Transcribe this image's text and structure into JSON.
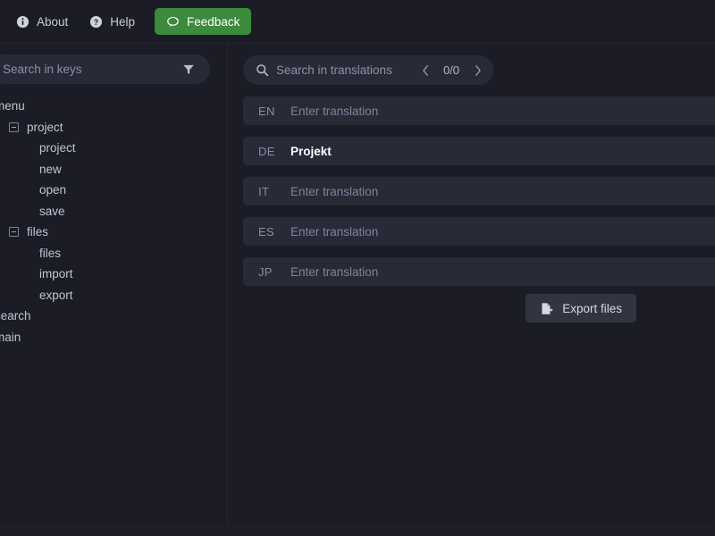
{
  "topbar": {
    "items": [
      {
        "label": "About",
        "icon": "info-circle-icon",
        "variant": "plain"
      },
      {
        "label": "Help",
        "icon": "question-circle-icon",
        "variant": "plain"
      },
      {
        "label": "Feedback",
        "icon": "speech-bubble-icon",
        "variant": "accent"
      }
    ],
    "accent_color": "#3c8b3c"
  },
  "sidebar": {
    "search": {
      "placeholder": "Search in keys",
      "value": "",
      "filter_icon": "filter-funnel-icon"
    },
    "tree": [
      {
        "label": "menu",
        "depth": 0,
        "expandable": false
      },
      {
        "label": "project",
        "depth": 1,
        "expandable": true
      },
      {
        "label": "project",
        "depth": 2,
        "expandable": false
      },
      {
        "label": "new",
        "depth": 2,
        "expandable": false
      },
      {
        "label": "open",
        "depth": 2,
        "expandable": false
      },
      {
        "label": "save",
        "depth": 2,
        "expandable": false
      },
      {
        "label": "files",
        "depth": 1,
        "expandable": true
      },
      {
        "label": "files",
        "depth": 2,
        "expandable": false
      },
      {
        "label": "import",
        "depth": 2,
        "expandable": false
      },
      {
        "label": "export",
        "depth": 2,
        "expandable": false
      },
      {
        "label": "search",
        "depth": 0,
        "expandable": false
      },
      {
        "label": "main",
        "depth": 0,
        "expandable": false
      }
    ]
  },
  "main": {
    "search": {
      "placeholder": "Search in translations",
      "value": "",
      "search_icon": "magnifier-icon",
      "prev_icon": "chevron-left-icon",
      "next_icon": "chevron-right-icon",
      "match_count": "0/0"
    },
    "translations": [
      {
        "code": "EN",
        "value": "",
        "placeholder": "Enter translation"
      },
      {
        "code": "DE",
        "value": "Projekt",
        "placeholder": "Enter translation"
      },
      {
        "code": "IT",
        "value": "",
        "placeholder": "Enter translation"
      },
      {
        "code": "ES",
        "value": "",
        "placeholder": "Enter translation"
      },
      {
        "code": "JP",
        "value": "",
        "placeholder": "Enter translation"
      }
    ],
    "export": {
      "label": "Export files",
      "icon": "file-export-icon"
    }
  }
}
